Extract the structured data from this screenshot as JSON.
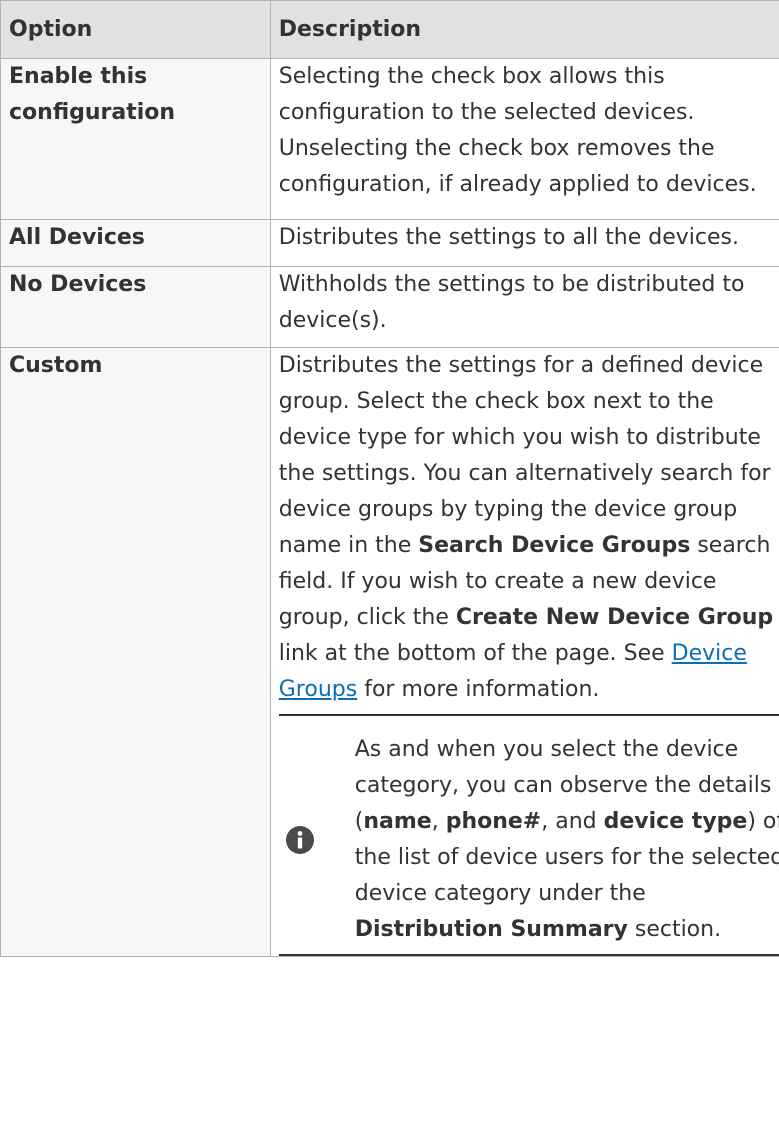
{
  "table": {
    "headers": {
      "option": "Option",
      "description": "Description"
    },
    "rows": {
      "enable": {
        "option": "Enable this configuration",
        "description": "Selecting the check box allows this configuration to the selected devices. Unselecting the check box removes the configuration, if already applied to devices."
      },
      "all": {
        "option": "All Devices",
        "description": "Distributes the settings to all the devices."
      },
      "none": {
        "option": "No Devices",
        "description": "Withholds the settings to be distributed to device(s)."
      },
      "custom": {
        "option": "Custom",
        "text_1": "Distributes the settings for a defined device group. Select the check box next to the device type for which you wish to distribute the settings. You can alternatively search for device groups by typing the device group name in the ",
        "bold_search": "Search Device Groups",
        "text_2": " search field. If you wish to create a new device group, click the ",
        "bold_create": "Create New Device Group",
        "text_3": " link at the bottom of the page. See ",
        "link_text": "Device Groups",
        "text_4": " for more information.",
        "note": {
          "icon": "info-icon",
          "text_1": "As and when you select the device category, you can observe the details (",
          "bold_name": "name",
          "sep_1": ", ",
          "bold_phone": "phone#",
          "sep_2": ", and ",
          "bold_type": "device type",
          "text_2": ") of the list of device users for the selected device category under the ",
          "bold_summary": "Distribution Summary",
          "text_3": " section."
        }
      }
    }
  }
}
